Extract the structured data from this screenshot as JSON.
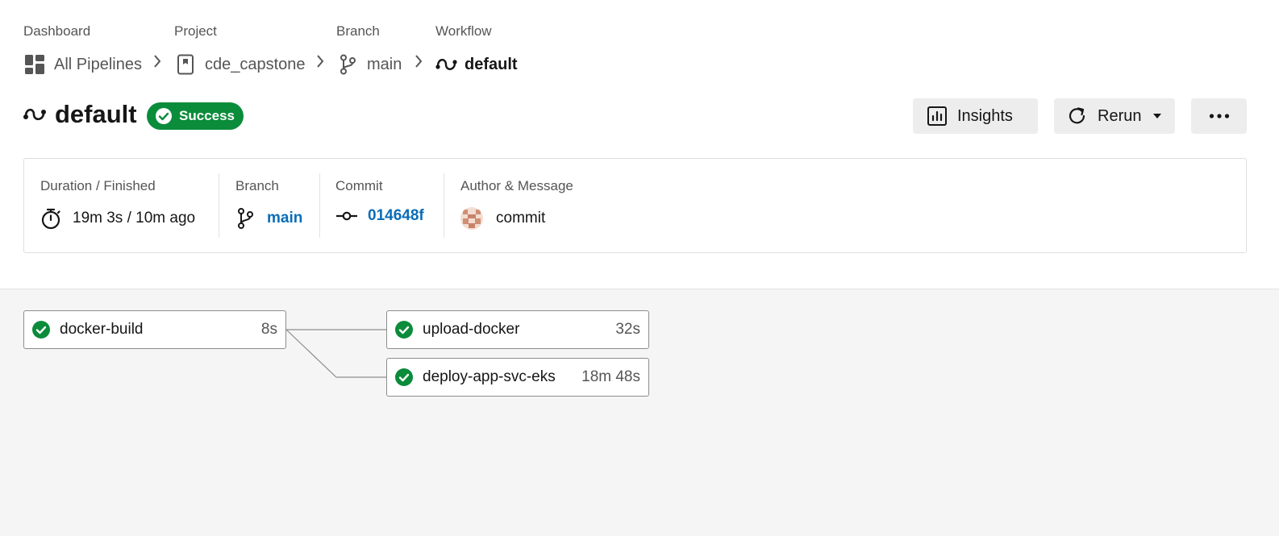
{
  "breadcrumb": {
    "dashboard": {
      "label": "Dashboard",
      "value": "All Pipelines"
    },
    "project": {
      "label": "Project",
      "value": "cde_capstone"
    },
    "branch": {
      "label": "Branch",
      "value": "main"
    },
    "workflow": {
      "label": "Workflow",
      "value": "default"
    }
  },
  "header": {
    "title": "default",
    "status": "Success",
    "insights_label": "Insights",
    "rerun_label": "Rerun"
  },
  "info": {
    "duration": {
      "label": "Duration / Finished",
      "value": "19m 3s / 10m ago"
    },
    "branch": {
      "label": "Branch",
      "value": "main"
    },
    "commit": {
      "label": "Commit",
      "value": "014648f"
    },
    "author": {
      "label": "Author & Message",
      "value": "commit"
    }
  },
  "jobs": [
    {
      "name": "docker-build",
      "duration": "8s"
    },
    {
      "name": "upload-docker",
      "duration": "32s"
    },
    {
      "name": "deploy-app-svc-eks",
      "duration": "18m 48s"
    }
  ],
  "colors": {
    "success": "#0a8c3b",
    "link": "#0a6db8"
  }
}
